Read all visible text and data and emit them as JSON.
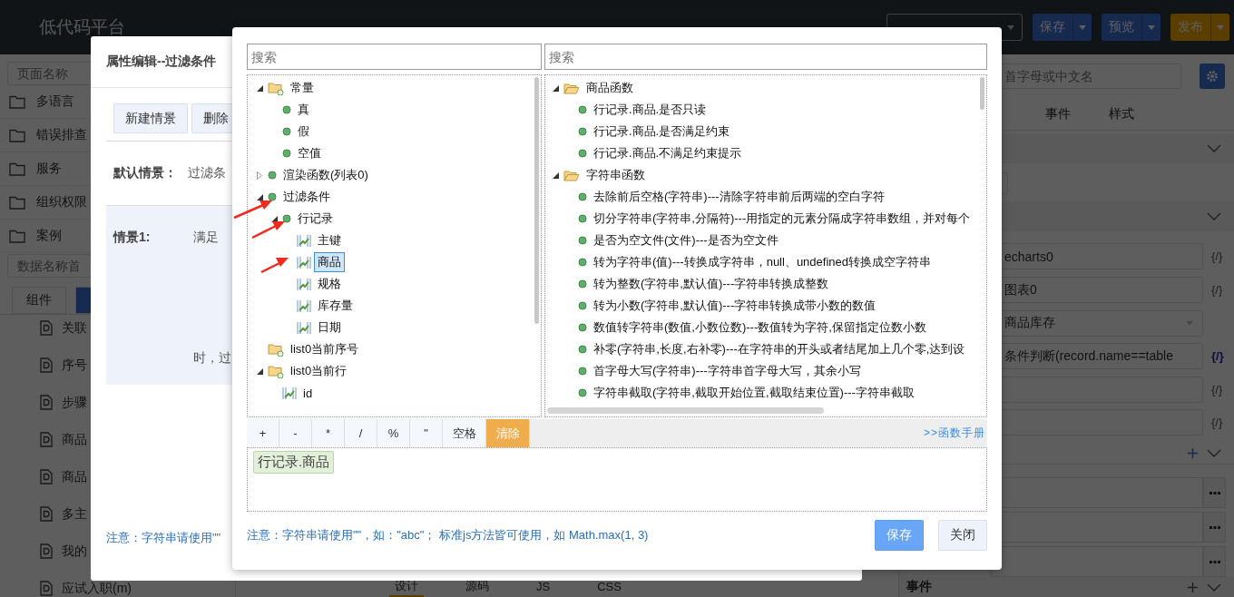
{
  "topbar": {
    "logo": "低代码平台",
    "actions": [
      {
        "label": "保存",
        "kind": "primary"
      },
      {
        "label": "预览",
        "kind": "primary"
      },
      {
        "label": "发布",
        "kind": "warning"
      }
    ]
  },
  "sidebar": {
    "page_search": {
      "placeholder": "页面名称"
    },
    "folders": [
      "多语言",
      "错误排查",
      "服务",
      "组织权限",
      "案例"
    ],
    "data_search": {
      "placeholder": "数据名称首"
    },
    "tabs": [
      {
        "label": "组件",
        "selected": false
      },
      {
        "selected": true
      }
    ],
    "data_items": [
      "关联",
      "序号",
      "步骤",
      "商品",
      "商品",
      "多主",
      "我的",
      "应试入职(m)"
    ]
  },
  "editor_tabs": [
    {
      "label": "设计",
      "selected": true
    },
    {
      "label": "源码",
      "selected": false
    },
    {
      "label": "JS",
      "selected": false
    },
    {
      "label": "CSS",
      "selected": false
    }
  ],
  "properties": {
    "search": {
      "placeholder": "首字母或中文名"
    },
    "tabs": [
      {
        "label": "事件",
        "selected": false
      },
      {
        "label": "样式",
        "selected": false
      }
    ],
    "fields": [
      {
        "kind": "text",
        "value": "echarts0",
        "binding": "{/}",
        "bound": false
      },
      {
        "kind": "text",
        "value": "图表0",
        "binding": "{/}",
        "bound": false
      },
      {
        "kind": "select",
        "value": "商品库存"
      },
      {
        "kind": "text",
        "value": "条件判断(record.name==table",
        "binding": "{/}",
        "bound": true
      },
      {
        "kind": "text",
        "binding": "{/}",
        "bound": false
      },
      {
        "kind": "text",
        "binding": "{/}",
        "bound": false
      }
    ],
    "list_rows": [
      {
        "kind": "menu"
      },
      {
        "kind": "menu"
      },
      {
        "kind": "menu"
      }
    ],
    "events_header": "事件"
  },
  "filter_dialog": {
    "title": "属性编辑--过滤条件",
    "buttons": [
      "新建情景",
      "删除"
    ],
    "default_label": "默认情景：",
    "default_value": "过滤条",
    "scenario_label": "情景1:",
    "scenario_prefix": "满足",
    "scenario_suffix": "时，过",
    "note": "注意：字符串请使用\"\""
  },
  "expression_dialog": {
    "left_search": {
      "placeholder": "搜索"
    },
    "right_search": {
      "placeholder": "搜索"
    },
    "variables": [
      {
        "label": "常量",
        "kind": "folder",
        "expanded": true,
        "selected": false,
        "children": [
          {
            "label": "真",
            "kind": "item",
            "selected": false
          },
          {
            "label": "假",
            "kind": "item",
            "selected": false
          },
          {
            "label": "空值",
            "kind": "item",
            "selected": false
          }
        ]
      },
      {
        "label": "渲染函数(列表0)",
        "kind": "item",
        "expanded": false,
        "selected": false
      },
      {
        "label": "过滤条件",
        "kind": "item",
        "expanded": true,
        "selected": false,
        "children": [
          {
            "label": "行记录",
            "kind": "item",
            "expanded": true,
            "selected": false,
            "children": [
              {
                "label": "主键",
                "kind": "field",
                "selected": false
              },
              {
                "label": "商品",
                "kind": "field",
                "selected": true
              },
              {
                "label": "规格",
                "kind": "field",
                "selected": false
              },
              {
                "label": "库存量",
                "kind": "field",
                "selected": false
              },
              {
                "label": "日期",
                "kind": "field",
                "selected": false
              }
            ]
          }
        ]
      },
      {
        "label": "list0当前序号",
        "kind": "folder",
        "selected": false
      },
      {
        "label": "list0当前行",
        "kind": "folder",
        "expanded": true,
        "selected": false,
        "children": [
          {
            "label": "id",
            "kind": "field",
            "selected": false
          }
        ]
      }
    ],
    "functions": [
      {
        "label": "商品函数",
        "kind": "category",
        "expanded": true,
        "selected": false,
        "children": [
          {
            "label": "行记录.商品.是否只读",
            "kind": "item",
            "selected": false
          },
          {
            "label": "行记录.商品.是否满足约束",
            "kind": "item",
            "selected": false
          },
          {
            "label": "行记录.商品.不满足约束提示",
            "kind": "item",
            "selected": false
          }
        ]
      },
      {
        "label": "字符串函数",
        "kind": "category",
        "expanded": true,
        "selected": false,
        "children": [
          {
            "label": "去除前后空格(字符串)---清除字符串前后两端的空白字符",
            "kind": "item",
            "selected": false
          },
          {
            "label": "切分字符串(字符串,分隔符)---用指定的元素分隔成字符串数组，并对每个",
            "kind": "item",
            "selected": false
          },
          {
            "label": "是否为空文件(文件)---是否为空文件",
            "kind": "item",
            "selected": false
          },
          {
            "label": "转为字符串(值)---转换成字符串，null、undefined转换成空字符串",
            "kind": "item",
            "selected": false
          },
          {
            "label": "转为整数(字符串,默认值)---字符串转换成整数",
            "kind": "item",
            "selected": false
          },
          {
            "label": "转为小数(字符串,默认值)---字符串转换成带小数的数值",
            "kind": "item",
            "selected": false
          },
          {
            "label": "数值转字符串(数值,小数位数)---数值转为字符,保留指定位数小数",
            "kind": "item",
            "selected": false
          },
          {
            "label": "补零(字符串,长度,右补零)---在字符串的开头或者结尾加上几个零,达到设",
            "kind": "item",
            "selected": false
          },
          {
            "label": "首字母大写(字符串)---字符串首字母大写，其余小写",
            "kind": "item",
            "selected": false
          },
          {
            "label": "字符串截取(字符串,截取开始位置,截取结束位置)---字符串截取",
            "kind": "item",
            "selected": false
          }
        ]
      }
    ],
    "operators": [
      {
        "label": "+",
        "kind": "op"
      },
      {
        "label": "-",
        "kind": "op"
      },
      {
        "label": "*",
        "kind": "op"
      },
      {
        "label": "/",
        "kind": "op"
      },
      {
        "label": "%",
        "kind": "op"
      },
      {
        "label": "\"",
        "kind": "op"
      },
      {
        "label": "空格",
        "kind": "op"
      },
      {
        "label": "清除",
        "kind": "clear"
      }
    ],
    "manual_link": ">>函数手册",
    "expression_tokens": [
      "行记录.商品"
    ],
    "note": "注意：字符串请使用\"\"，如：\"abc\"； 标准js方法皆可使用，如 Math.max(1, 3)",
    "buttons": [
      {
        "label": "保存",
        "kind": "primary"
      },
      {
        "label": "关闭",
        "kind": "default"
      }
    ]
  }
}
